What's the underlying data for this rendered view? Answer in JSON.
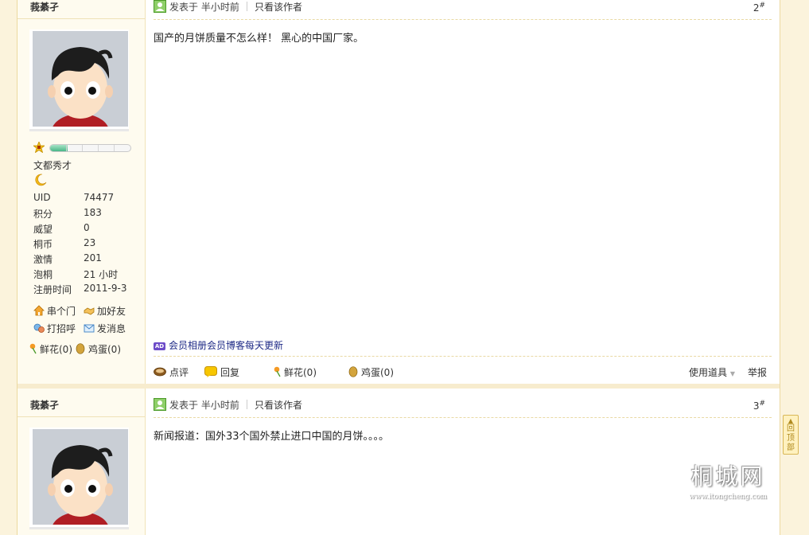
{
  "posts": [
    {
      "author": "莪綦孑",
      "rank_title": "文都秀才",
      "rank_progress": 0.22,
      "stats": [
        {
          "label": "UID",
          "value": "74477"
        },
        {
          "label": "积分",
          "value": "183"
        },
        {
          "label": "威望",
          "value": "0"
        },
        {
          "label": "桐币",
          "value": "23"
        },
        {
          "label": "激情",
          "value": "201"
        },
        {
          "label": "泡桐",
          "value": "21 小时"
        },
        {
          "label": "注册时间",
          "value": "2011-9-3"
        }
      ],
      "side_actions": {
        "visit": "串个门",
        "add_friend": "加好友",
        "greet": "打招呼",
        "message": "发消息",
        "flowers": "鲜花(0)",
        "eggs": "鸡蛋(0)"
      },
      "posted": "发表于 半小时前",
      "only_author": "只看该作者",
      "floor": "2",
      "floor_mark": "#",
      "content": "国产的月饼质量不怎么样！ 黑心的中国厂家。",
      "ad_badge": "AD",
      "ad_text": "会员相册会员博客每天更新",
      "footer": {
        "comment": "点评",
        "reply": "回复",
        "flowers": "鲜花(0)",
        "eggs": "鸡蛋(0)",
        "tools": "使用道具",
        "report": "举报"
      }
    },
    {
      "author": "莪綦孑",
      "posted": "发表于 半小时前",
      "only_author": "只看该作者",
      "floor": "3",
      "floor_mark": "#",
      "content": "新闻报道：国外33个国外禁止进口中国的月饼。。。。"
    }
  ],
  "back_to_top": "回顶部",
  "watermark": {
    "title": "桐城网",
    "url": "www.itongcheng.com"
  },
  "colors": {
    "accent": "#1e2a86",
    "border": "#ecd9a0",
    "sidebar_bg": "#fefbef",
    "page_bg": "#fbf3dc"
  }
}
